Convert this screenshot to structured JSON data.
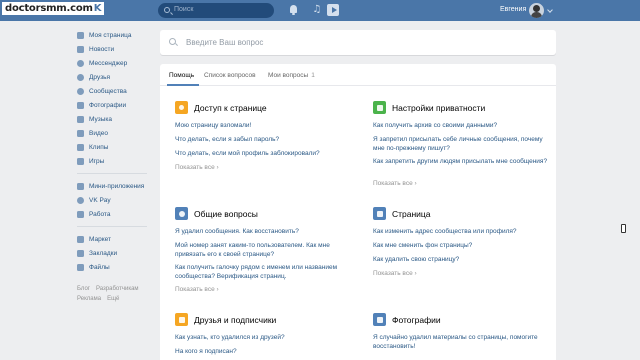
{
  "header": {
    "logo_text": "doctorsmm.com",
    "logo_vk": "K",
    "search_placeholder": "Поиск",
    "user_name": "Евгения",
    "icons": [
      "bell-icon",
      "music-icon",
      "play-icon",
      "chevron-down-icon"
    ],
    "accent": "#4a76a8"
  },
  "sidebar": {
    "items": [
      {
        "label": "Моя страница",
        "icon": "home-icon"
      },
      {
        "label": "Новости",
        "icon": "news-icon"
      },
      {
        "label": "Мессенджер",
        "icon": "messenger-icon"
      },
      {
        "label": "Друзья",
        "icon": "friends-icon"
      },
      {
        "label": "Сообщества",
        "icon": "communities-icon"
      },
      {
        "label": "Фотографии",
        "icon": "photos-icon"
      },
      {
        "label": "Музыка",
        "icon": "music-icon"
      },
      {
        "label": "Видео",
        "icon": "video-icon"
      },
      {
        "label": "Клипы",
        "icon": "clips-icon"
      },
      {
        "label": "Игры",
        "icon": "games-icon"
      }
    ],
    "items2": [
      {
        "label": "Мини-приложения",
        "icon": "apps-icon"
      },
      {
        "label": "VK Pay",
        "icon": "vkpay-icon"
      },
      {
        "label": "Работа",
        "icon": "work-icon"
      }
    ],
    "items3": [
      {
        "label": "Маркет",
        "icon": "market-icon"
      },
      {
        "label": "Закладки",
        "icon": "bookmarks-icon"
      },
      {
        "label": "Файлы",
        "icon": "files-icon"
      }
    ],
    "footer": [
      "Блог",
      "Разработчикам",
      "Реклама",
      "Ещё"
    ]
  },
  "main": {
    "search_placeholder": "Введите Ваш вопрос",
    "tabs": [
      {
        "label": "Помощь"
      },
      {
        "label": "Список вопросов"
      },
      {
        "label": "Мои вопросы",
        "count": "1"
      }
    ],
    "show_all": "Показать все",
    "cards": [
      {
        "title": "Доступ к странице",
        "icon": "key-icon",
        "color": "#f5a623",
        "questions": [
          "Мою страницу взломали!",
          "Что делать, если я забыл пароль?",
          "Что делать, если мой профиль заблокировали?"
        ]
      },
      {
        "title": "Настройки приватности",
        "icon": "lock-icon",
        "color": "#4bb34b",
        "questions": [
          "Как получить архив со своими данными?",
          "Я запретил присылать себе личные сообщения, почему мне по-прежнему пишут?",
          "Как запретить другим людям присылать мне сообщения?"
        ]
      },
      {
        "title": "Общие вопросы",
        "icon": "star-icon",
        "color": "#5181b8",
        "questions": [
          "Я удалил сообщения. Как восстановить?",
          "Мой номер занят каким-то пользователем. Как мне привязать его к своей странице?",
          "Как получить галочку рядом с именем или названием сообщества? Верификация страниц."
        ]
      },
      {
        "title": "Страница",
        "icon": "page-icon",
        "color": "#5181b8",
        "questions": [
          "Как изменить адрес сообщества или профиля?",
          "Как мне сменить фон страницы?",
          "Как удалить свою страницу?"
        ]
      },
      {
        "title": "Друзья и подписчики",
        "icon": "person-icon",
        "color": "#f5a623",
        "questions": [
          "Как узнать, кто удалился из друзей?",
          "На кого я подписан?"
        ]
      },
      {
        "title": "Фотографии",
        "icon": "camera-icon",
        "color": "#5181b8",
        "questions": [
          "Я случайно удалил материалы со страницы, помогите восстановить!"
        ]
      }
    ]
  }
}
